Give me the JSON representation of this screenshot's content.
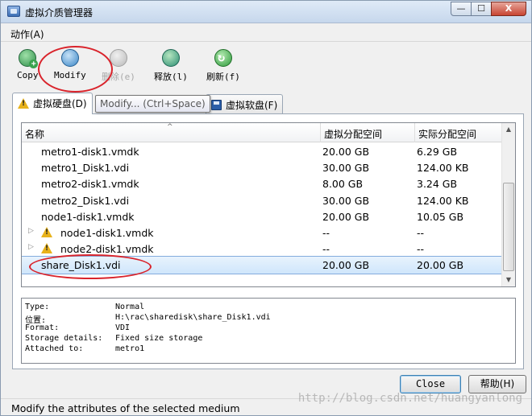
{
  "window": {
    "title": "虚拟介质管理器",
    "min_glyph": "—",
    "max_glyph": "☐",
    "close_glyph": "X"
  },
  "menu": {
    "action": "动作(A)"
  },
  "toolbar": {
    "copy": "Copy",
    "modify": "Modify",
    "delete": "删除(e)",
    "release": "释放(l)",
    "refresh": "刷新(f)"
  },
  "tabs": {
    "hard_disks": "虚拟硬盘(D)",
    "floppy_disks": "虚拟软盘(F)"
  },
  "tooltip": "Modify... (Ctrl+Space)",
  "table": {
    "columns": [
      "名称",
      "虚拟分配空间",
      "实际分配空间"
    ],
    "sort_glyph": "^",
    "rows": [
      {
        "name": "metro1-disk1.vmdk",
        "virtual": "20.00 GB",
        "actual": "6.29 GB"
      },
      {
        "name": "metro1_Disk1.vdi",
        "virtual": "30.00 GB",
        "actual": "124.00 KB"
      },
      {
        "name": "metro2-disk1.vmdk",
        "virtual": "8.00 GB",
        "actual": "3.24 GB"
      },
      {
        "name": "metro2_Disk1.vdi",
        "virtual": "30.00 GB",
        "actual": "124.00 KB"
      },
      {
        "name": "node1-disk1.vmdk",
        "virtual": "20.00 GB",
        "actual": "10.05 GB"
      },
      {
        "name": "node1-disk1.vmdk",
        "virtual": "--",
        "actual": "--"
      },
      {
        "name": "node2-disk1.vmdk",
        "virtual": "--",
        "actual": "--"
      },
      {
        "name": "share_Disk1.vdi",
        "virtual": "20.00 GB",
        "actual": "20.00 GB"
      }
    ]
  },
  "details": {
    "type_label": "Type:",
    "type_value": "Normal",
    "location_label": "位置:",
    "location_value": "H:\\rac\\sharedisk\\share_Disk1.vdi",
    "format_label": "Format:",
    "format_value": "VDI",
    "storage_label": "Storage details:",
    "storage_value": "Fixed size storage",
    "attached_label": "Attached to:",
    "attached_value": "metro1"
  },
  "buttons": {
    "close": "Close",
    "help": "帮助(H)"
  },
  "status": "Modify the attributes of the selected medium",
  "watermark": "http://blog.csdn.net/huangyanlong",
  "colors": {
    "annotation": "#d9232b",
    "selection": "#cfe6fb"
  }
}
